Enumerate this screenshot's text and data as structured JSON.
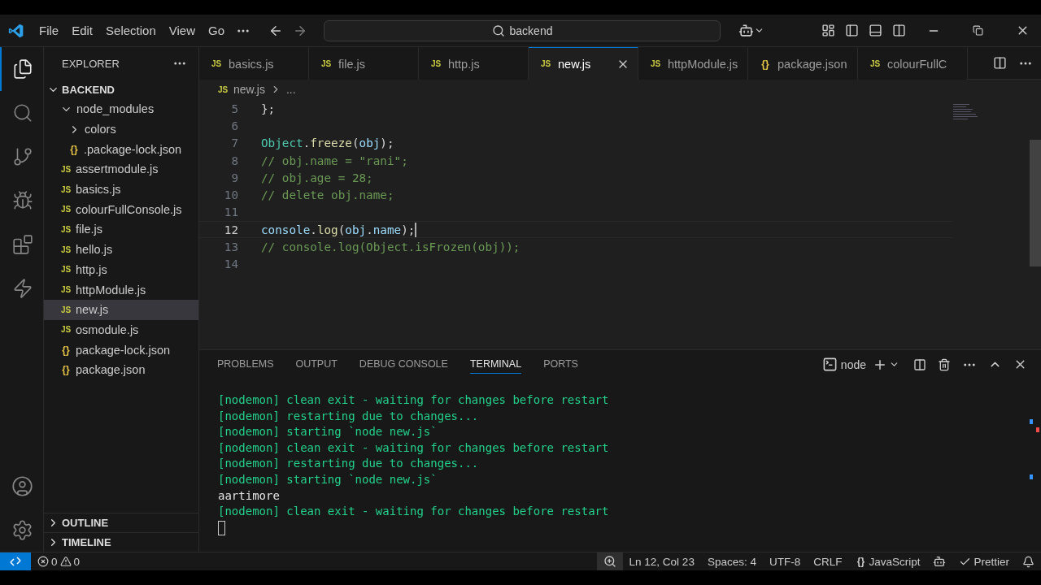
{
  "menu": [
    "File",
    "Edit",
    "Selection",
    "View",
    "Go"
  ],
  "search": {
    "value": "backend"
  },
  "activity_bar": [
    {
      "kind": "explorer",
      "selected": true
    },
    {
      "kind": "search",
      "selected": false
    },
    {
      "kind": "source",
      "selected": false
    },
    {
      "kind": "debug",
      "selected": false
    },
    {
      "kind": "extensions",
      "selected": false
    },
    {
      "kind": "bolt",
      "selected": false
    }
  ],
  "sidebar": {
    "title": "EXPLORER",
    "sections": [
      {
        "label": "BACKEND",
        "expanded": true,
        "children": [
          {
            "label": "node_modules",
            "kind": "folder",
            "expanded": true,
            "selected": false,
            "children": [
              {
                "label": "colors",
                "kind": "folder",
                "expanded": false,
                "selected": false
              },
              {
                "label": ".package-lock.json",
                "kind": "json",
                "badge": "{}",
                "selected": false
              }
            ]
          },
          {
            "label": "assertmodule.js",
            "kind": "js",
            "badge": "JS",
            "selected": false
          },
          {
            "label": "basics.js",
            "kind": "js",
            "badge": "JS",
            "selected": false
          },
          {
            "label": "colourFullConsole.js",
            "kind": "js",
            "badge": "JS",
            "selected": false
          },
          {
            "label": "file.js",
            "kind": "js",
            "badge": "JS",
            "selected": false
          },
          {
            "label": "hello.js",
            "kind": "js",
            "badge": "JS",
            "selected": false
          },
          {
            "label": "http.js",
            "kind": "js",
            "badge": "JS",
            "selected": false
          },
          {
            "label": "httpModule.js",
            "kind": "js",
            "badge": "JS",
            "selected": false
          },
          {
            "label": "new.js",
            "kind": "js",
            "badge": "JS",
            "selected": true
          },
          {
            "label": "osmodule.js",
            "kind": "js",
            "badge": "JS",
            "selected": false
          },
          {
            "label": "package-lock.json",
            "kind": "json",
            "badge": "{}",
            "selected": false
          },
          {
            "label": "package.json",
            "kind": "json",
            "badge": "{}",
            "selected": false
          }
        ]
      },
      {
        "label": "OUTLINE",
        "expanded": false
      },
      {
        "label": "TIMELINE",
        "expanded": false
      }
    ]
  },
  "tabs": [
    {
      "label": "basics.js",
      "badge": "JS",
      "kind": "js",
      "selected": false
    },
    {
      "label": "file.js",
      "badge": "JS",
      "kind": "js",
      "selected": false
    },
    {
      "label": "http.js",
      "badge": "JS",
      "kind": "js",
      "selected": false
    },
    {
      "label": "new.js",
      "badge": "JS",
      "kind": "js",
      "selected": true
    },
    {
      "label": "httpModule.js",
      "badge": "JS",
      "kind": "js",
      "selected": false
    },
    {
      "label": "package.json",
      "badge": "{}",
      "kind": "json",
      "selected": false
    },
    {
      "label": "colourFullC",
      "badge": "JS",
      "kind": "js",
      "selected": false
    }
  ],
  "breadcrumb": {
    "badge": "JS",
    "file": "new.js",
    "rest": "..."
  },
  "code": {
    "lines": [
      {
        "number": "5",
        "current": false,
        "tokens": [
          {
            "text": "};",
            "kind": "plain"
          }
        ]
      },
      {
        "number": "6",
        "current": false
      },
      {
        "number": "7",
        "current": false,
        "tokens": [
          {
            "text": "Object",
            "kind": "type"
          },
          {
            "text": ".",
            "kind": "plain"
          },
          {
            "text": "freeze",
            "kind": "func"
          },
          {
            "text": "(",
            "kind": "plain"
          },
          {
            "text": "obj",
            "kind": "var"
          },
          {
            "text": ");",
            "kind": "plain"
          }
        ]
      },
      {
        "number": "8",
        "current": false,
        "tokens": [
          {
            "text": "// obj.name = \"rani\";",
            "kind": "comment"
          }
        ]
      },
      {
        "number": "9",
        "current": false,
        "tokens": [
          {
            "text": "// obj.age = 28;",
            "kind": "comment"
          }
        ]
      },
      {
        "number": "10",
        "current": false,
        "tokens": [
          {
            "text": "// delete obj.name;",
            "kind": "comment"
          }
        ]
      },
      {
        "number": "11",
        "current": false
      },
      {
        "number": "12",
        "current": true,
        "tokens": [
          {
            "text": "console",
            "kind": "var"
          },
          {
            "text": ".",
            "kind": "plain"
          },
          {
            "text": "log",
            "kind": "func"
          },
          {
            "text": "(",
            "kind": "plain"
          },
          {
            "text": "obj",
            "kind": "var"
          },
          {
            "text": ".",
            "kind": "plain"
          },
          {
            "text": "name",
            "kind": "var"
          },
          {
            "text": ");",
            "kind": "plain"
          }
        ]
      },
      {
        "number": "13",
        "current": false,
        "tokens": [
          {
            "text": "// console.log(Object.isFrozen(obj));",
            "kind": "comment"
          }
        ]
      },
      {
        "number": "14",
        "current": false
      }
    ]
  },
  "panel": {
    "tabs": [
      {
        "label": "PROBLEMS",
        "selected": false
      },
      {
        "label": "OUTPUT",
        "selected": false
      },
      {
        "label": "DEBUG CONSOLE",
        "selected": false
      },
      {
        "label": "TERMINAL",
        "selected": true
      },
      {
        "label": "PORTS",
        "selected": false
      }
    ],
    "terminal_name": "node",
    "lines": [
      {
        "text": "[nodemon] clean exit - waiting for changes before restart",
        "kind": "nodemon"
      },
      {
        "text": "[nodemon] restarting due to changes...",
        "kind": "nodemon"
      },
      {
        "text": "[nodemon] starting `node new.js`",
        "kind": "nodemon"
      },
      {
        "text": "[nodemon] clean exit - waiting for changes before restart",
        "kind": "nodemon"
      },
      {
        "text": "[nodemon] restarting due to changes...",
        "kind": "nodemon"
      },
      {
        "text": "[nodemon] starting `node new.js`",
        "kind": "nodemon"
      },
      {
        "text": "aartimore",
        "kind": "output"
      },
      {
        "text": "[nodemon] clean exit - waiting for changes before restart",
        "kind": "nodemon"
      }
    ]
  },
  "status_bar": {
    "errors": "0",
    "warnings": "0",
    "items": [
      "Ln 12, Col 23",
      "Spaces: 4",
      "UTF-8",
      "CRLF"
    ],
    "language_badge": "{}",
    "language": "JavaScript",
    "formatter": "Prettier"
  }
}
